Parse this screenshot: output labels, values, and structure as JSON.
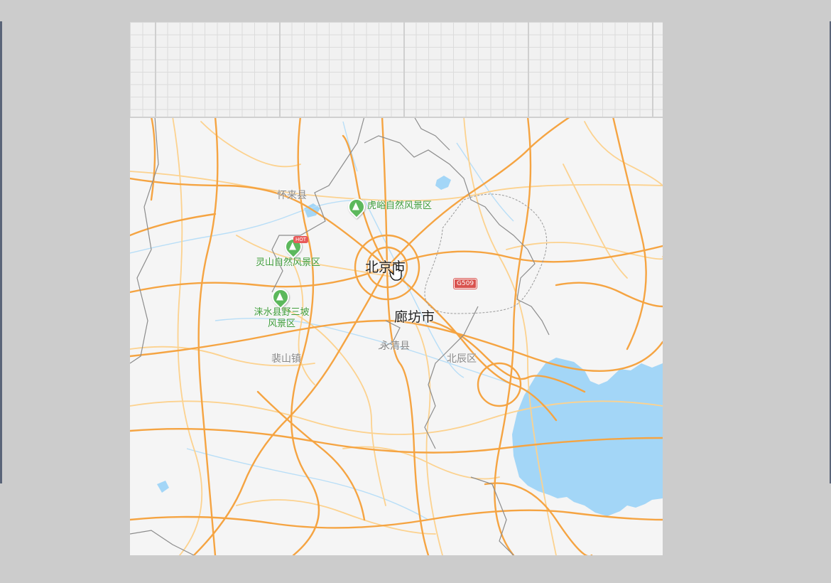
{
  "map": {
    "labels": {
      "beijing": "北京市",
      "langfang": "廊坊市",
      "huailai": "怀来县",
      "yongqing": "永清县",
      "beichen": "北辰区",
      "peishan": "裴山镇"
    },
    "pois": {
      "huyu": "虎峪自然风景区",
      "lingshan": "灵山自然风景区",
      "laishui_line1": "涞水县野三坡",
      "laishui_line2": "风景区",
      "hot_badge": "HOT"
    },
    "road_shields": {
      "g509": "G509"
    },
    "colors": {
      "highway": "#f5a442",
      "minor_road": "#fcd28f",
      "water": "#a3d6f7",
      "river": "#b8def7",
      "border": "#8c8c8c",
      "land": "#f5f5f5",
      "poi_green": "#5cb85c"
    }
  }
}
